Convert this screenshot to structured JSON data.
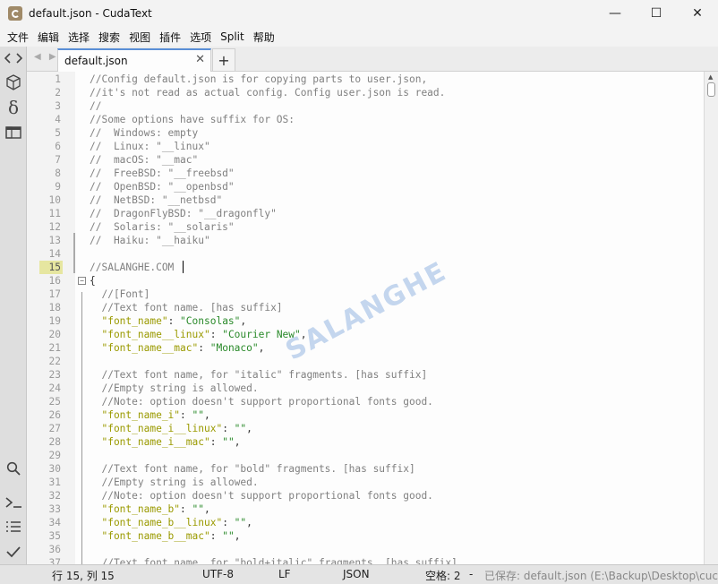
{
  "window": {
    "title": "default.json - CudaText",
    "minimize": "—",
    "maximize": "☐",
    "close": "✕",
    "brand_color": "#a08a68"
  },
  "menu": [
    "文件",
    "编辑",
    "选择",
    "搜索",
    "视图",
    "插件",
    "选项",
    "Split",
    "帮助"
  ],
  "sidebar": {
    "icons": [
      "code-icon",
      "cube-icon",
      "delta-icon",
      "panel-icon",
      "search-icon",
      "console-icon",
      "list-icon",
      "check-icon"
    ]
  },
  "tabs": {
    "active_label": "default.json",
    "close": "✕",
    "add": "+",
    "arrows": "◀ ▶"
  },
  "editor": {
    "current_line": "15",
    "watermark": "SALANGHE",
    "lines": [
      {
        "n": "1",
        "code": [
          [
            "cmt",
            "//Config default.json is for copying parts to user.json,"
          ]
        ]
      },
      {
        "n": "2",
        "code": [
          [
            "cmt",
            "//it's not read as actual config. Config user.json is read."
          ]
        ]
      },
      {
        "n": "3",
        "code": [
          [
            "cmt",
            "//"
          ]
        ]
      },
      {
        "n": "4",
        "code": [
          [
            "cmt",
            "//Some options have suffix for OS:"
          ]
        ]
      },
      {
        "n": "5",
        "code": [
          [
            "cmt",
            "//  Windows: empty"
          ]
        ]
      },
      {
        "n": "6",
        "code": [
          [
            "cmt",
            "//  Linux: \"__linux\""
          ]
        ]
      },
      {
        "n": "7",
        "code": [
          [
            "cmt",
            "//  macOS: \"__mac\""
          ]
        ]
      },
      {
        "n": "8",
        "code": [
          [
            "cmt",
            "//  FreeBSD: \"__freebsd\""
          ]
        ]
      },
      {
        "n": "9",
        "code": [
          [
            "cmt",
            "//  OpenBSD: \"__openbsd\""
          ]
        ]
      },
      {
        "n": "10",
        "code": [
          [
            "cmt",
            "//  NetBSD: \"__netbsd\""
          ]
        ]
      },
      {
        "n": "11",
        "code": [
          [
            "cmt",
            "//  DragonFlyBSD: \"__dragonfly\""
          ]
        ]
      },
      {
        "n": "12",
        "code": [
          [
            "cmt",
            "//  Solaris: \"__solaris\""
          ]
        ]
      },
      {
        "n": "13",
        "code": [
          [
            "cmt",
            "//  Haiku: \"__haiku\""
          ]
        ]
      },
      {
        "n": "14",
        "code": []
      },
      {
        "n": "15",
        "code": [
          [
            "cmt",
            "//SALANGHE.COM"
          ]
        ]
      },
      {
        "n": "16",
        "code": [
          [
            "pun",
            "{"
          ]
        ]
      },
      {
        "n": "17",
        "code": [
          [
            "cmt",
            "  //[Font]"
          ]
        ]
      },
      {
        "n": "18",
        "code": [
          [
            "cmt",
            "  //Text font name. [has suffix]"
          ]
        ]
      },
      {
        "n": "19",
        "code": [
          [
            "key",
            "  \"font_name\""
          ],
          [
            "pun",
            ": "
          ],
          [
            "str",
            "\"Consolas\""
          ],
          [
            "pun",
            ","
          ]
        ]
      },
      {
        "n": "20",
        "code": [
          [
            "key",
            "  \"font_name__linux\""
          ],
          [
            "pun",
            ": "
          ],
          [
            "str",
            "\"Courier New\""
          ],
          [
            "pun",
            ","
          ]
        ]
      },
      {
        "n": "21",
        "code": [
          [
            "key",
            "  \"font_name__mac\""
          ],
          [
            "pun",
            ": "
          ],
          [
            "str",
            "\"Monaco\""
          ],
          [
            "pun",
            ","
          ]
        ]
      },
      {
        "n": "22",
        "code": []
      },
      {
        "n": "23",
        "code": [
          [
            "cmt",
            "  //Text font name, for \"italic\" fragments. [has suffix]"
          ]
        ]
      },
      {
        "n": "24",
        "code": [
          [
            "cmt",
            "  //Empty string is allowed."
          ]
        ]
      },
      {
        "n": "25",
        "code": [
          [
            "cmt",
            "  //Note: option doesn't support proportional fonts good."
          ]
        ]
      },
      {
        "n": "26",
        "code": [
          [
            "key",
            "  \"font_name_i\""
          ],
          [
            "pun",
            ": "
          ],
          [
            "str",
            "\"\""
          ],
          [
            "pun",
            ","
          ]
        ]
      },
      {
        "n": "27",
        "code": [
          [
            "key",
            "  \"font_name_i__linux\""
          ],
          [
            "pun",
            ": "
          ],
          [
            "str",
            "\"\""
          ],
          [
            "pun",
            ","
          ]
        ]
      },
      {
        "n": "28",
        "code": [
          [
            "key",
            "  \"font_name_i__mac\""
          ],
          [
            "pun",
            ": "
          ],
          [
            "str",
            "\"\""
          ],
          [
            "pun",
            ","
          ]
        ]
      },
      {
        "n": "29",
        "code": []
      },
      {
        "n": "30",
        "code": [
          [
            "cmt",
            "  //Text font name, for \"bold\" fragments. [has suffix]"
          ]
        ]
      },
      {
        "n": "31",
        "code": [
          [
            "cmt",
            "  //Empty string is allowed."
          ]
        ]
      },
      {
        "n": "32",
        "code": [
          [
            "cmt",
            "  //Note: option doesn't support proportional fonts good."
          ]
        ]
      },
      {
        "n": "33",
        "code": [
          [
            "key",
            "  \"font_name_b\""
          ],
          [
            "pun",
            ": "
          ],
          [
            "str",
            "\"\""
          ],
          [
            "pun",
            ","
          ]
        ]
      },
      {
        "n": "34",
        "code": [
          [
            "key",
            "  \"font_name_b__linux\""
          ],
          [
            "pun",
            ": "
          ],
          [
            "str",
            "\"\""
          ],
          [
            "pun",
            ","
          ]
        ]
      },
      {
        "n": "35",
        "code": [
          [
            "key",
            "  \"font_name_b__mac\""
          ],
          [
            "pun",
            ": "
          ],
          [
            "str",
            "\"\""
          ],
          [
            "pun",
            ","
          ]
        ]
      },
      {
        "n": "36",
        "code": []
      },
      {
        "n": "37",
        "code": [
          [
            "cmt",
            "  //Text font name, for \"bold+italic\" fragments. [has suffix]"
          ]
        ]
      }
    ]
  },
  "status": {
    "position": "行 15, 列 15",
    "encoding": "UTF-8",
    "line_ending": "LF",
    "lexer": "JSON",
    "indent": "空格: 2",
    "dash": "-",
    "message": "已保存: default.json (E:\\Backup\\Desktop\\cuc"
  }
}
